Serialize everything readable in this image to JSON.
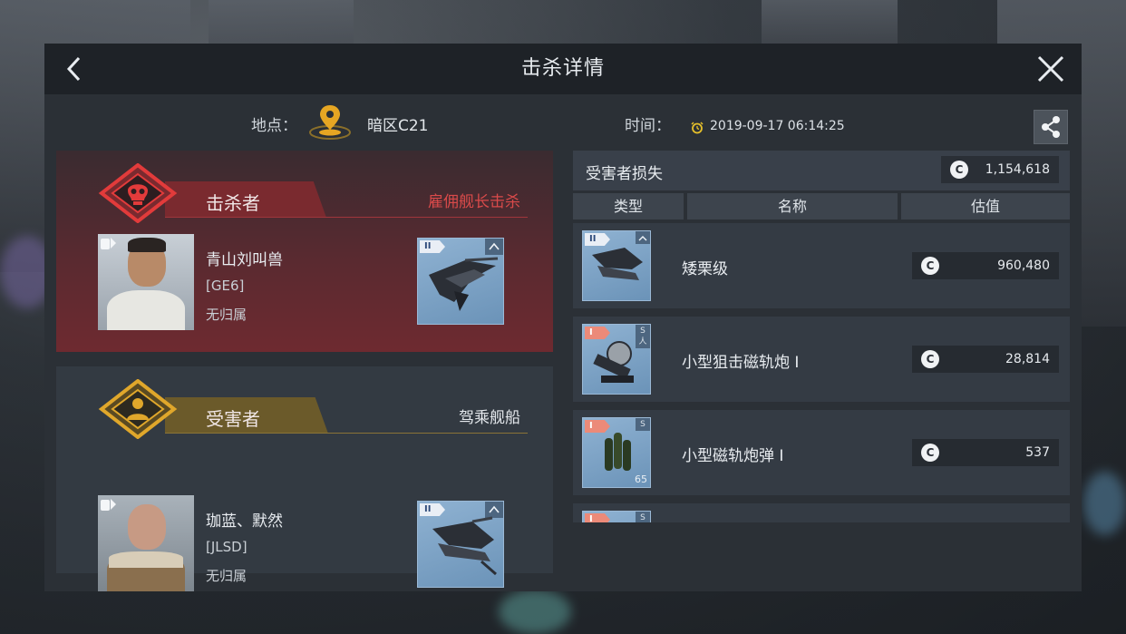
{
  "window": {
    "title": "击杀详情"
  },
  "info": {
    "location_label": "地点：",
    "location_value": "暗区C21",
    "time_label": "时间：",
    "time_value": "2019-09-17 06:14:25"
  },
  "killer": {
    "role_label": "击杀者",
    "note": "雇佣舰长击杀",
    "name": "青山刘叫兽",
    "corp": "[GE6]",
    "alliance": "无归属",
    "ship_tier": "II"
  },
  "victim": {
    "role_label": "受害者",
    "note": "驾乘舰船",
    "name": "珈蓝、默然",
    "corp": "[JLSD]",
    "alliance": "无归属",
    "ship_tier": "II"
  },
  "losses": {
    "title": "受害者损失",
    "total_value": "1,154,618",
    "currency_symbol": "C",
    "columns": [
      "类型",
      "名称",
      "估值"
    ],
    "items": [
      {
        "tier": "II",
        "tier_color": "#e9eef5",
        "slot": "",
        "qty": "",
        "name": "矮栗级",
        "value": "960,480"
      },
      {
        "tier": "I",
        "tier_color": "#ec8a79",
        "slot": "S\n人",
        "qty": "",
        "name": "小型狙击磁轨炮 I",
        "value": "28,814"
      },
      {
        "tier": "I",
        "tier_color": "#ec8a79",
        "slot": "S",
        "qty": "65",
        "name": "小型磁轨炮弹 I",
        "value": "537"
      },
      {
        "tier": "I",
        "tier_color": "#ec8a79",
        "slot": "S",
        "qty": "",
        "name": "",
        "value": ""
      }
    ]
  },
  "colors": {
    "panel_bg": "#2b3036",
    "header_bg": "#1e2227",
    "killer_accent": "#d94a4a",
    "victim_accent": "#e0a72b",
    "location_pin": "#e6a623"
  }
}
